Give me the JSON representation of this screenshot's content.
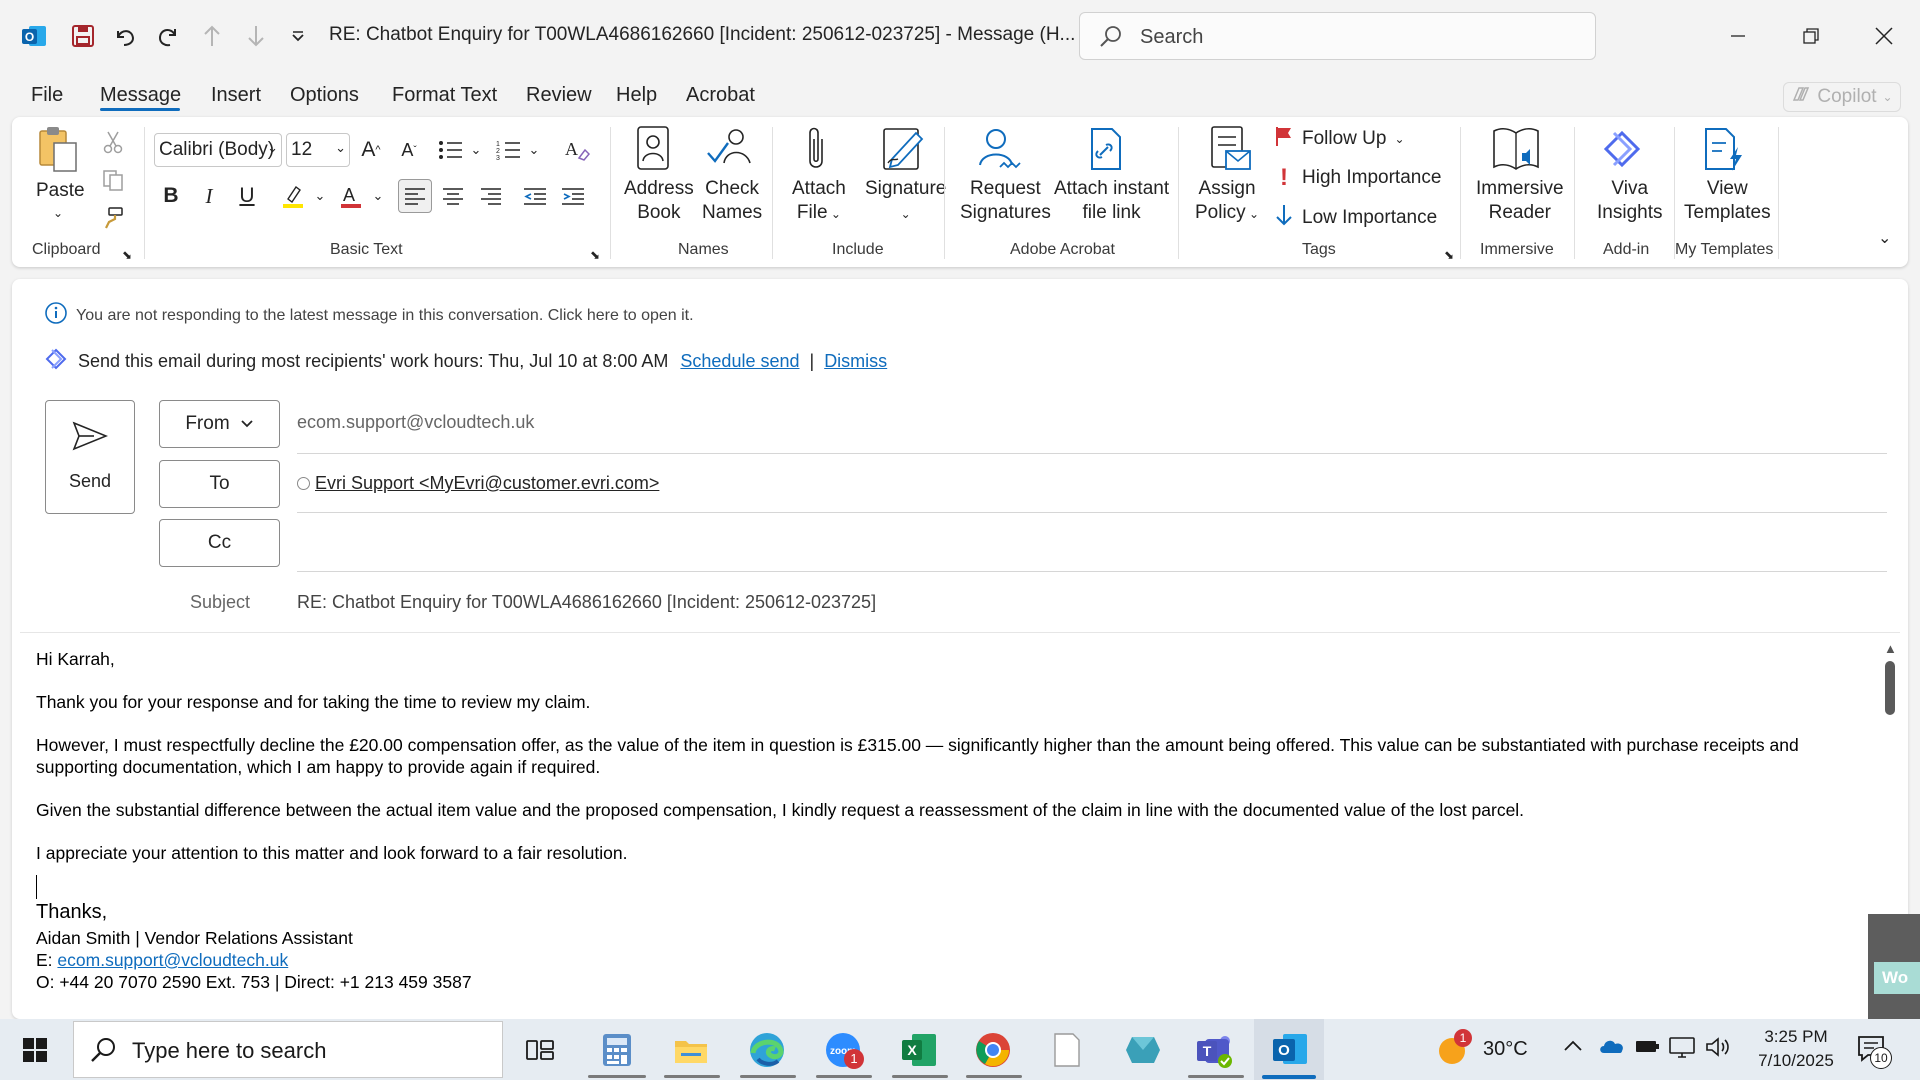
{
  "window": {
    "title": "RE: Chatbot Enquiry for T00WLA4686162660 [Incident: 250612-023725]  -  Message (H...",
    "search_placeholder": "Search"
  },
  "menu": {
    "tabs": [
      "File",
      "Message",
      "Insert",
      "Options",
      "Format Text",
      "Review",
      "Help",
      "Acrobat"
    ],
    "active": "Message",
    "copilot": "Copilot"
  },
  "ribbon": {
    "clipboard": {
      "paste": "Paste",
      "group": "Clipboard"
    },
    "basic_text": {
      "font": "Calibri (Body)",
      "size": "12",
      "group": "Basic Text"
    },
    "names": {
      "address_book": [
        "Address",
        "Book"
      ],
      "check_names": [
        "Check",
        "Names"
      ],
      "group": "Names"
    },
    "include": {
      "attach_file": [
        "Attach",
        "File"
      ],
      "signature": "Signature",
      "group": "Include"
    },
    "adobe": {
      "request_signatures": [
        "Request",
        "Signatures"
      ],
      "attach_link": [
        "Attach instant",
        "file link"
      ],
      "group": "Adobe Acrobat"
    },
    "tags": {
      "assign_policy": [
        "Assign",
        "Policy"
      ],
      "follow_up": "Follow Up",
      "high_importance": "High Importance",
      "low_importance": "Low Importance",
      "group": "Tags"
    },
    "immersive": {
      "reader": [
        "Immersive",
        "Reader"
      ],
      "group": "Immersive"
    },
    "addin": {
      "viva": [
        "Viva",
        "Insights"
      ],
      "group": "Add-in"
    },
    "templates": {
      "view": [
        "View",
        "Templates"
      ],
      "group": "My Templates"
    }
  },
  "notices": {
    "not_responding": "You are not responding to the latest message in this conversation. Click here to open it.",
    "send_hint": "Send this email during most recipients' work hours: Thu, Jul 10 at 8:00 AM",
    "schedule_send": "Schedule send",
    "divider": "|",
    "dismiss": "Dismiss"
  },
  "compose": {
    "send": "Send",
    "from_label": "From",
    "from_value": "ecom.support@vcloudtech.uk",
    "to_label": "To",
    "to_value": "Evri Support <MyEvri@customer.evri.com>",
    "cc_label": "Cc",
    "subject_label": "Subject",
    "subject_value": "RE: Chatbot Enquiry for T00WLA4686162660 [Incident: 250612-023725]"
  },
  "body": {
    "greeting": "Hi Karrah,",
    "p1": "Thank you for your response and for taking the time to review my claim.",
    "p2_line1": "However, I must respectfully decline the £20.00 compensation offer, as the value of the item in question is £315.00 — significantly higher than the amount being offered. This value can be substantiated with purchase receipts and",
    "p2_line2": "supporting documentation, which I am happy to provide again if required.",
    "p3": "Given the substantial difference between the actual item value and the proposed compensation, I kindly request a reassessment of the claim in line with the documented value of the lost parcel.",
    "p4": "I appreciate your attention to this matter and look forward to a fair resolution.",
    "signoff": "Thanks,",
    "sig_name": "Aidan Smith | Vendor Relations Assistant",
    "sig_email_label": "E:",
    "sig_email": "ecom.support@vcloudtech.uk",
    "sig_phone": "O:  +44 20 7070 2590 Ext. 753 | Direct: +1 213 459 3587"
  },
  "taskbar": {
    "search_placeholder": "Type here to search",
    "zoom_badge": "1",
    "weather_badge": "1",
    "temperature": "30°C",
    "time": "3:25 PM",
    "date": "7/10/2025",
    "notification_count": "10",
    "side_peek": "Wo"
  }
}
